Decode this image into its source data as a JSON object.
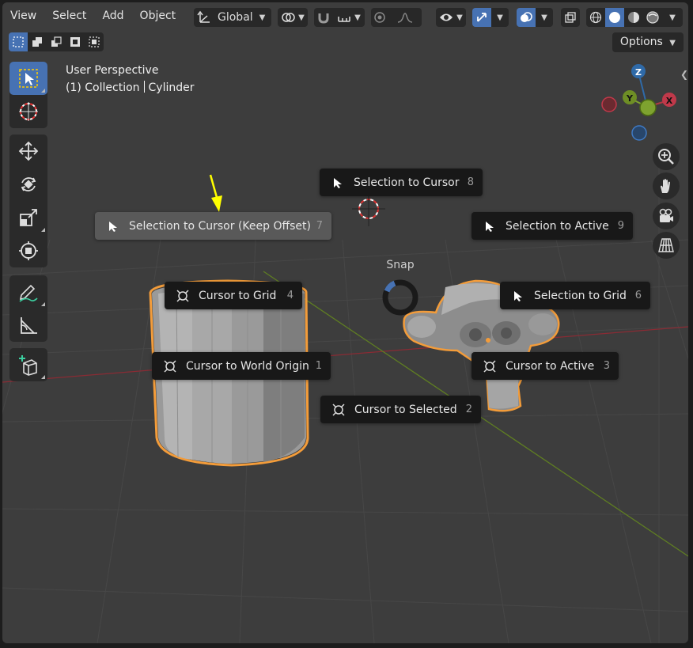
{
  "header": {
    "menus": [
      "View",
      "Select",
      "Add",
      "Object"
    ],
    "transform_orientation": "Global",
    "options_label": "Options"
  },
  "viewport_info": {
    "perspective": "User Perspective",
    "collection": "(1) Collection",
    "object": "Cylinder"
  },
  "gizmo": {
    "z": "Z",
    "y": "Y",
    "x": "X"
  },
  "pie_menu": {
    "title": "Snap",
    "items": [
      {
        "label": "Selection to Cursor (Keep Offset)",
        "key": "7",
        "icon": "cursor-arrow-icon"
      },
      {
        "label": "Selection to Cursor",
        "key": "8",
        "icon": "cursor-arrow-icon"
      },
      {
        "label": "Selection to Active",
        "key": "9",
        "icon": "cursor-arrow-icon"
      },
      {
        "label": "Cursor to Grid",
        "key": "4",
        "icon": "3d-cursor-icon"
      },
      {
        "label": "Selection to Grid",
        "key": "6",
        "icon": "cursor-arrow-icon"
      },
      {
        "label": "Cursor to World Origin",
        "key": "1",
        "icon": "3d-cursor-icon"
      },
      {
        "label": "Cursor to Active",
        "key": "3",
        "icon": "3d-cursor-icon"
      },
      {
        "label": "Cursor to Selected",
        "key": "2",
        "icon": "3d-cursor-icon"
      }
    ]
  },
  "colors": {
    "accent": "#4772b3",
    "selection_outline": "#f39c3a",
    "axis_x": "#b23a44",
    "axis_y": "#7ea22f",
    "pointer_arrow": "#ffff00"
  }
}
